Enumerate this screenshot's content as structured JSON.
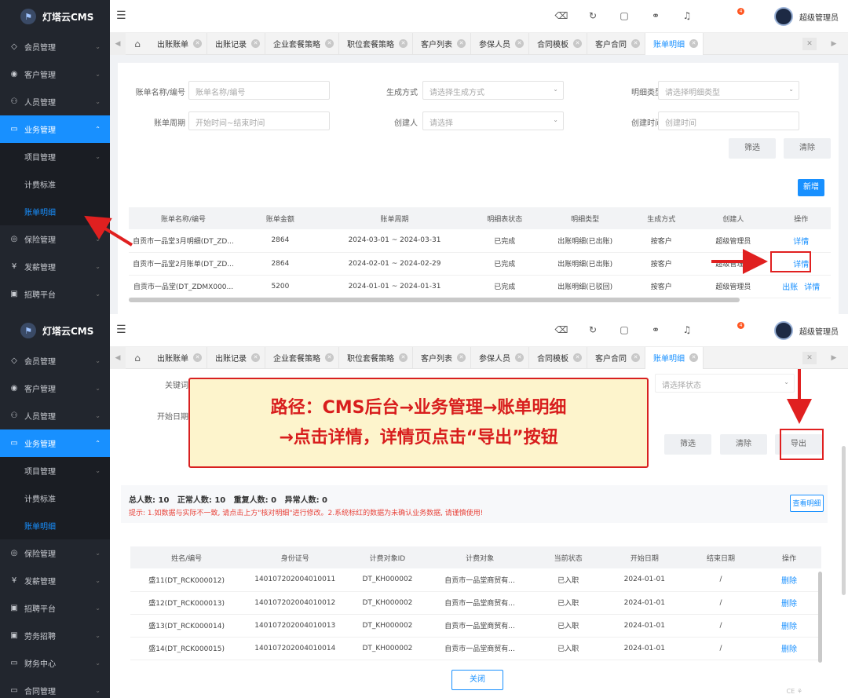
{
  "app": {
    "name": "灯塔云CMS",
    "user": "超级管理员",
    "notification_count": "4"
  },
  "sidebar1": [
    {
      "icon": "◇",
      "label": "会员管理"
    },
    {
      "icon": "◉",
      "label": "客户管理"
    },
    {
      "icon": "⚇",
      "label": "人员管理"
    },
    {
      "icon": "▭",
      "label": "业务管理",
      "active": true
    },
    {
      "sub": true,
      "label": "项目管理",
      "chev": true
    },
    {
      "sub": true,
      "label": "计费标准"
    },
    {
      "sub": true,
      "label": "账单明细",
      "sel": true
    },
    {
      "icon": "◎",
      "label": "保险管理"
    },
    {
      "icon": "¥",
      "label": "发薪管理"
    },
    {
      "icon": "▣",
      "label": "招聘平台"
    }
  ],
  "sidebar2": [
    {
      "icon": "◇",
      "label": "会员管理"
    },
    {
      "icon": "◉",
      "label": "客户管理"
    },
    {
      "icon": "⚇",
      "label": "人员管理"
    },
    {
      "icon": "▭",
      "label": "业务管理",
      "active": true
    },
    {
      "sub": true,
      "label": "项目管理",
      "chev": true
    },
    {
      "sub": true,
      "label": "计费标准"
    },
    {
      "sub": true,
      "label": "账单明细",
      "sel": true
    },
    {
      "icon": "◎",
      "label": "保险管理"
    },
    {
      "icon": "¥",
      "label": "发薪管理"
    },
    {
      "icon": "▣",
      "label": "招聘平台"
    },
    {
      "icon": "▣",
      "label": "劳务招聘"
    },
    {
      "icon": "▭",
      "label": "财务中心"
    },
    {
      "icon": "▭",
      "label": "合同管理"
    }
  ],
  "tabs": [
    "出账账单",
    "出账记录",
    "企业套餐策略",
    "职位套餐策略",
    "客户列表",
    "参保人员",
    "合同模板",
    "客户合同",
    "账单明细"
  ],
  "active_tab": "账单明细",
  "filters1": {
    "name_label": "账单名称/编号",
    "name_placeholder": "账单名称/编号",
    "method_label": "生成方式",
    "method_placeholder": "请选择生成方式",
    "type_label": "明细类型",
    "type_placeholder": "请选择明细类型",
    "period_label": "账单周期",
    "period_placeholder": "开始时间~结束时间",
    "creator_label": "创建人",
    "creator_placeholder": "请选择",
    "ctime_label": "创建时间",
    "ctime_placeholder": "创建时间",
    "filter_btn": "筛选",
    "clear_btn": "清除",
    "new_btn": "新增"
  },
  "bill_table": {
    "headers": [
      "账单名称/编号",
      "账单金额",
      "账单周期",
      "明细表状态",
      "明细类型",
      "生成方式",
      "创建人",
      "操作"
    ],
    "rows": [
      {
        "name": "自贡市一品堂3月明细(DT_ZD...",
        "amount": "2864",
        "period": "2024-03-01 ~ 2024-03-31",
        "status": "已完成",
        "type": "出账明细(已出账)",
        "method": "按客户",
        "creator": "超级管理员",
        "actions": [
          "详情"
        ]
      },
      {
        "name": "自贡市一品堂2月账单(DT_ZD...",
        "amount": "2864",
        "period": "2024-02-01 ~ 2024-02-29",
        "status": "已完成",
        "type": "出账明细(已出账)",
        "method": "按客户",
        "creator": "超级管理员",
        "actions": [
          "详情"
        ]
      },
      {
        "name": "自贡市一品堂(DT_ZDMX000...",
        "amount": "5200",
        "period": "2024-01-01 ~ 2024-01-31",
        "status": "已完成",
        "type": "出账明细(已驳回)",
        "method": "按客户",
        "creator": "超级管理员",
        "actions": [
          "出账",
          "详情"
        ]
      }
    ]
  },
  "filters2": {
    "keyword_label": "关键词",
    "start_label": "开始日期",
    "status_placeholder": "请选择状态",
    "filter_btn": "筛选",
    "clear_btn": "清除",
    "export_btn": "导出"
  },
  "stats": {
    "text": "总人数: 10   正常人数: 10   重复人数: 0   异常人数: 0",
    "view_btn": "查看明细"
  },
  "tip": "提示: 1.如数据与实际不一致, 请点击上方\"核对明细\"进行修改。2.系统标红的数据为未确认业务数据, 请谨慎使用!",
  "detail_table": {
    "headers": [
      "姓名/编号",
      "身份证号",
      "计费对象ID",
      "计费对象",
      "当前状态",
      "开始日期",
      "结束日期",
      "操作"
    ],
    "rows": [
      {
        "name": "盛11(DT_RCK000012)",
        "id": "140107202004010011",
        "oid": "DT_KH000002",
        "obj": "自贡市一品堂商贸有...",
        "state": "已入职",
        "start": "2024-01-01",
        "end": "/",
        "op": "删除"
      },
      {
        "name": "盛12(DT_RCK000013)",
        "id": "140107202004010012",
        "oid": "DT_KH000002",
        "obj": "自贡市一品堂商贸有...",
        "state": "已入职",
        "start": "2024-01-01",
        "end": "/",
        "op": "删除"
      },
      {
        "name": "盛13(DT_RCK000014)",
        "id": "140107202004010013",
        "oid": "DT_KH000002",
        "obj": "自贡市一品堂商贸有...",
        "state": "已入职",
        "start": "2024-01-01",
        "end": "/",
        "op": "删除"
      },
      {
        "name": "盛14(DT_RCK000015)",
        "id": "140107202004010014",
        "oid": "DT_KH000002",
        "obj": "自贡市一品堂商贸有...",
        "state": "已入职",
        "start": "2024-01-01",
        "end": "/",
        "op": "删除"
      }
    ]
  },
  "close_btn": "关闭",
  "callout": {
    "line1": "路径：CMS后台→业务管理→账单明细",
    "line2": "→点击详情，详情页点击“导出”按钮"
  },
  "colors": {
    "accent": "#1890ff",
    "sidebar": "#22262e",
    "annotation": "#e02020"
  }
}
